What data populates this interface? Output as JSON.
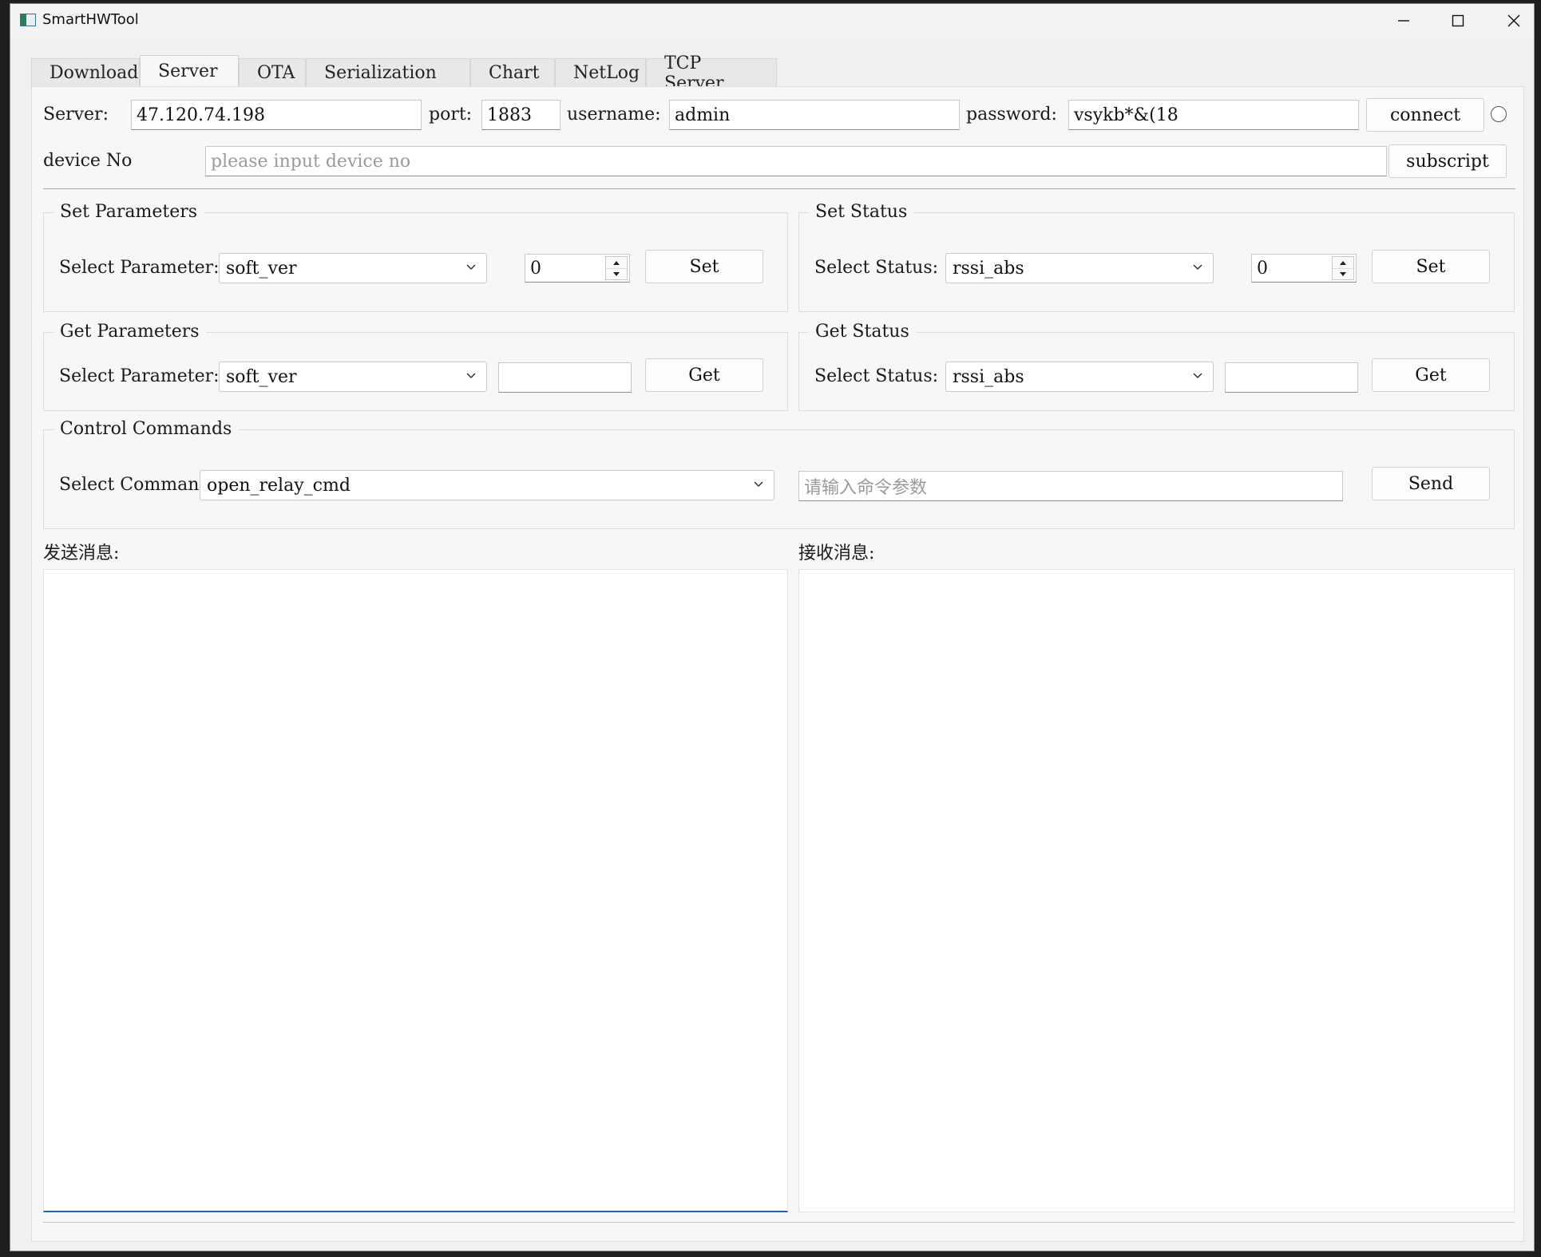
{
  "window": {
    "title": "SmartHWTool"
  },
  "tabs": [
    {
      "label": "Download"
    },
    {
      "label": "Server"
    },
    {
      "label": "OTA"
    },
    {
      "label": "Serialization"
    },
    {
      "label": "Chart"
    },
    {
      "label": "NetLog"
    },
    {
      "label": "TCP Server"
    }
  ],
  "active_tab": "Server",
  "connection": {
    "server_label": "Server:",
    "server_value": "47.120.74.198",
    "port_label": "port:",
    "port_value": "1883",
    "username_label": "username:",
    "username_value": "admin",
    "password_label": "password:",
    "password_value": "vsykb*&(18",
    "connect_label": "connect",
    "device_label": "device No",
    "device_placeholder": "please input device no",
    "subscript_label": "subscript"
  },
  "set_parameters": {
    "title": "Set Parameters",
    "select_label": "Select Parameter:",
    "selected": "soft_ver",
    "spin_value": "0",
    "button": "Set"
  },
  "set_status": {
    "title": "Set Status",
    "select_label": "Select Status:",
    "selected": "rssi_abs",
    "spin_value": "0",
    "button": "Set"
  },
  "get_parameters": {
    "title": "Get Parameters",
    "select_label": "Select Parameter:",
    "selected": "soft_ver",
    "result": "",
    "button": "Get"
  },
  "get_status": {
    "title": "Get Status",
    "select_label": "Select Status:",
    "selected": "rssi_abs",
    "result": "",
    "button": "Get"
  },
  "control": {
    "title": "Control Commands",
    "select_label": "Select Command:",
    "selected": "open_relay_cmd",
    "param_placeholder": "请输入命令参数",
    "button": "Send"
  },
  "messages": {
    "send_label": "发送消息:",
    "send_text": "",
    "receive_label": "接收消息:",
    "receive_text": ""
  }
}
